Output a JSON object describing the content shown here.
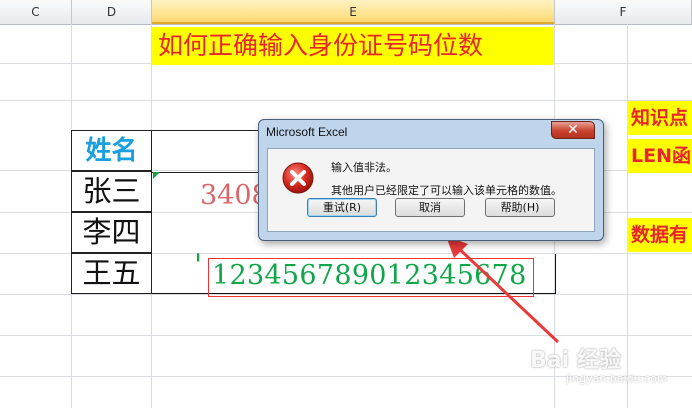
{
  "columns": [
    "C",
    "D",
    "E",
    "F"
  ],
  "title": "如何正确输入身份证号码位数",
  "side_notes": [
    "知识点",
    "LEN函",
    "数据有"
  ],
  "table": {
    "header": "姓名",
    "names": [
      "张三",
      "李四",
      "王五"
    ]
  },
  "cell_values": {
    "row1_partial": "3408",
    "row3_prefix": "'",
    "row3_typed": "123456789012345678"
  },
  "dialog": {
    "title": "Microsoft Excel",
    "close": "✕",
    "line1": "输入值非法。",
    "line2": "其他用户已经限定了可以输入该单元格的数值。",
    "buttons": {
      "retry": "重试(R)",
      "cancel": "取消",
      "help": "帮助(H)"
    }
  },
  "watermark": {
    "brand": "Bai 经验",
    "url": "jingyan.baidu.com"
  },
  "colors": {
    "title_bg": "#ffff00",
    "title_text": "#e8252d",
    "typed_text": "#12a64a",
    "arrow": "#e83a3a"
  }
}
